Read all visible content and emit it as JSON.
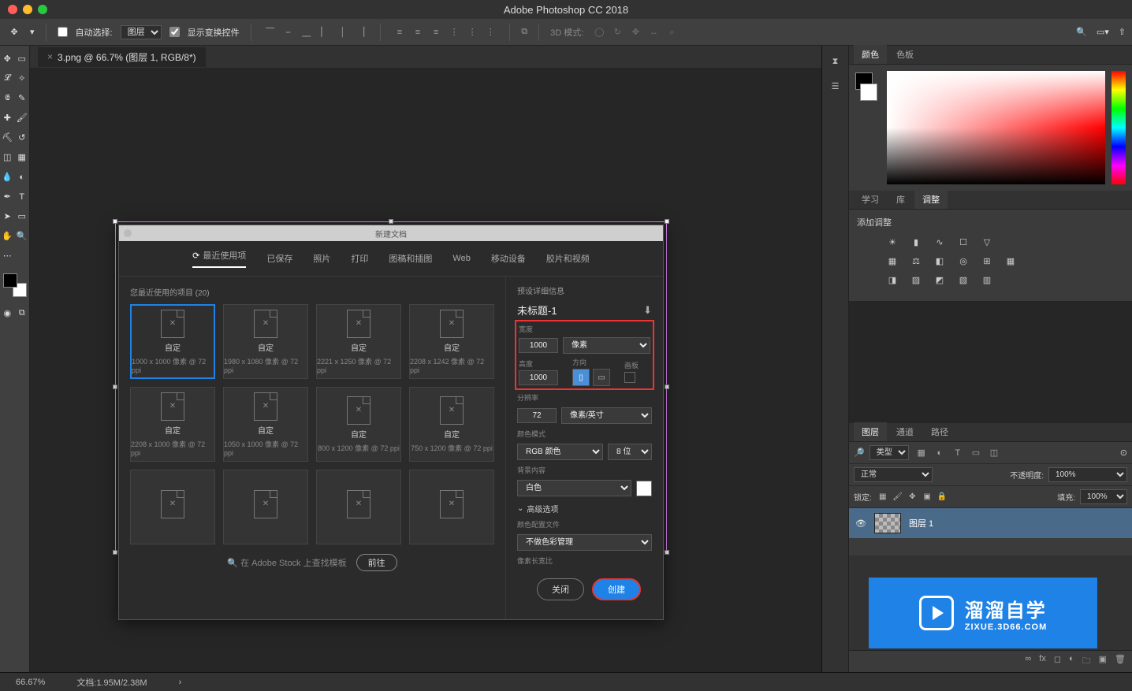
{
  "app_title": "Adobe Photoshop CC 2018",
  "options_bar": {
    "auto_select_label": "自动选择:",
    "auto_select_target": "图层",
    "show_transform_label": "显示变换控件",
    "mode_3d_label": "3D 模式:"
  },
  "document": {
    "tab_title": "3.png @ 66.7% (图层 1, RGB/8*)"
  },
  "new_doc_dialog": {
    "title": "新建文档",
    "tabs": [
      "最近使用项",
      "已保存",
      "照片",
      "打印",
      "图稿和插图",
      "Web",
      "移动设备",
      "胶片和视频"
    ],
    "active_tab_index": 0,
    "recent_heading": "您最近使用的项目  (20)",
    "presets": [
      {
        "name": "自定",
        "meta": "1000 x 1000 像素 @ 72 ppi",
        "selected": true
      },
      {
        "name": "自定",
        "meta": "1980 x 1080 像素 @ 72 ppi"
      },
      {
        "name": "自定",
        "meta": "2221 x 1250 像素 @ 72 ppi"
      },
      {
        "name": "自定",
        "meta": "2208 x 1242 像素 @ 72 ppi"
      },
      {
        "name": "自定",
        "meta": "2208 x 1000 像素 @ 72 ppi"
      },
      {
        "name": "自定",
        "meta": "1050 x 1000 像素 @ 72 ppi"
      },
      {
        "name": "自定",
        "meta": "800 x 1200 像素 @ 72 ppi"
      },
      {
        "name": "自定",
        "meta": "750 x 1200 像素 @ 72 ppi"
      },
      {
        "name": "",
        "meta": ""
      },
      {
        "name": "",
        "meta": ""
      },
      {
        "name": "",
        "meta": ""
      },
      {
        "name": "",
        "meta": ""
      }
    ],
    "search_placeholder": "在 Adobe Stock 上查找模板",
    "go_button": "前往",
    "detail_heading": "预设详细信息",
    "doc_name": "未标题-1",
    "width_label": "宽度",
    "width_value": "1000",
    "width_unit": "像素",
    "height_label": "高度",
    "height_value": "1000",
    "orient_label": "方向",
    "artboard_label": "画板",
    "resolution_label": "分辨率",
    "resolution_value": "72",
    "resolution_unit": "像素/英寸",
    "color_mode_label": "颜色模式",
    "color_mode_value": "RGB 颜色",
    "bit_depth": "8 位",
    "background_label": "背景内容",
    "background_value": "白色",
    "advanced_label": "高级选项",
    "profile_label": "颜色配置文件",
    "profile_value": "不做色彩管理",
    "pixel_ratio_label": "像素长宽比",
    "close_button": "关闭",
    "create_button": "创建"
  },
  "panels": {
    "color_tabs": [
      "颜色",
      "色板"
    ],
    "adjust_tabs": [
      "学习",
      "库",
      "调整"
    ],
    "adjust_label": "添加调整",
    "layer_tabs": [
      "图层",
      "通道",
      "路径"
    ],
    "filter_kind": "类型",
    "blend_mode": "正常",
    "opacity_label": "不透明度:",
    "opacity_value": "100%",
    "lock_label": "锁定:",
    "fill_label": "填充:",
    "fill_value": "100%",
    "layer_name": "图层 1"
  },
  "status": {
    "zoom": "66.67%",
    "docinfo": "文档:1.95M/2.38M"
  },
  "watermark": {
    "big": "溜溜自学",
    "small": "ZIXUE.3D66.COM"
  }
}
